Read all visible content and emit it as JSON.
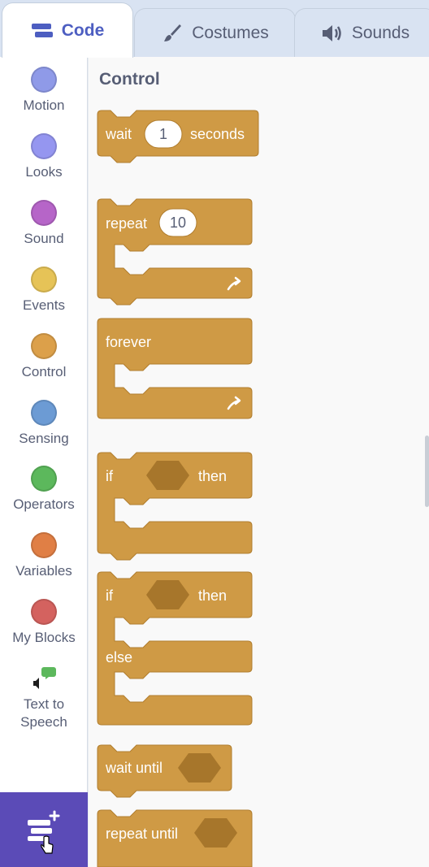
{
  "tabs": {
    "code": "Code",
    "costumes": "Costumes",
    "sounds": "Sounds"
  },
  "categories": [
    {
      "label": "Motion",
      "color": "#8f9ae8"
    },
    {
      "label": "Looks",
      "color": "#9596f0"
    },
    {
      "label": "Sound",
      "color": "#b665c8"
    },
    {
      "label": "Events",
      "color": "#e6c357"
    },
    {
      "label": "Control",
      "color": "#dca04a"
    },
    {
      "label": "Sensing",
      "color": "#6c9bd4"
    },
    {
      "label": "Operators",
      "color": "#5cb85c"
    },
    {
      "label": "Variables",
      "color": "#e07f45"
    },
    {
      "label": "My Blocks",
      "color": "#d4625f"
    },
    {
      "label": "Text to Speech",
      "color": "",
      "icon": "text-to-speech-icon"
    }
  ],
  "palette": {
    "title": "Control",
    "blocks": {
      "wait_prefix": "wait",
      "wait_value": "1",
      "wait_suffix": "seconds",
      "repeat_label": "repeat",
      "repeat_value": "10",
      "forever_label": "forever",
      "if_label": "if",
      "then_label": "then",
      "ifelse_if_label": "if",
      "ifelse_then_label": "then",
      "else_label": "else",
      "wait_until_label": "wait until",
      "repeat_until_label": "repeat until"
    }
  },
  "colors": {
    "control_block": "#cf9a45",
    "extension_button": "#5b4bb7",
    "active_tab_text": "#4d5ec1"
  }
}
